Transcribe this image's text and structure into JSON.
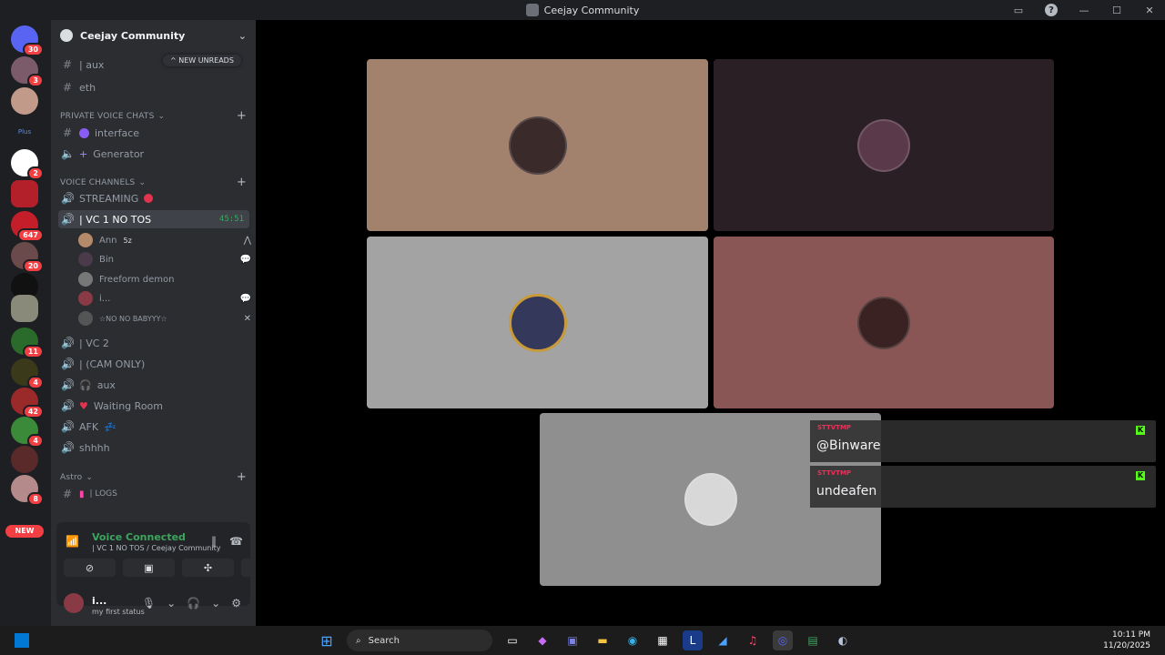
{
  "window": {
    "title": "Ceejay Community"
  },
  "guild_badges": [
    "30",
    "3",
    "2",
    "647",
    "20",
    "11",
    "4",
    "42",
    "4",
    "8"
  ],
  "guild_new_label": "NEW",
  "server": {
    "name": "Ceejay Community"
  },
  "new_unreads_label": "NEW UNREADS",
  "channels_top": [
    {
      "name": "| aux"
    },
    {
      "name": "eth"
    }
  ],
  "categories": {
    "private_voice": "PRIVATE VOICE CHATS",
    "voice_channels": "VOICE CHANNELS",
    "astro": "Astro"
  },
  "private_channels": [
    {
      "name": "interface"
    },
    {
      "name": "Generator"
    }
  ],
  "voice_channels": [
    {
      "name": "STREAMING"
    },
    {
      "name": "| VC 1 NO TOS",
      "time": "45:51"
    },
    {
      "name": "| VC 2"
    },
    {
      "name": "| (CAM ONLY)"
    },
    {
      "name": "aux"
    },
    {
      "name": "Waiting Room"
    },
    {
      "name": "AFK"
    },
    {
      "name": "shhhh"
    }
  ],
  "vc_users": [
    {
      "name": "Ann",
      "extra": "5z"
    },
    {
      "name": "Bin"
    },
    {
      "name": "Freeform demon"
    },
    {
      "name": "i..."
    },
    {
      "name": "☆NO NO BABYYY☆"
    }
  ],
  "astro_channels": [
    {
      "name": "| LOGS"
    }
  ],
  "voice_panel": {
    "status": "Voice Connected",
    "sub": "| VC 1 NO TOS / Ceejay Community"
  },
  "user_panel": {
    "name": "i...",
    "status": "my first status"
  },
  "overlays": [
    {
      "tag": "STTVTMP",
      "handle": "@Binware"
    },
    {
      "tag": "STTVTMP",
      "handle": "undeafen"
    }
  ],
  "taskbar": {
    "search": "Search",
    "time": "10:11 PM",
    "date": "11/20/2025"
  },
  "colors": {
    "accent_green": "#3ba55d",
    "badge_red": "#f23f43",
    "kick_green": "#53fc18"
  }
}
